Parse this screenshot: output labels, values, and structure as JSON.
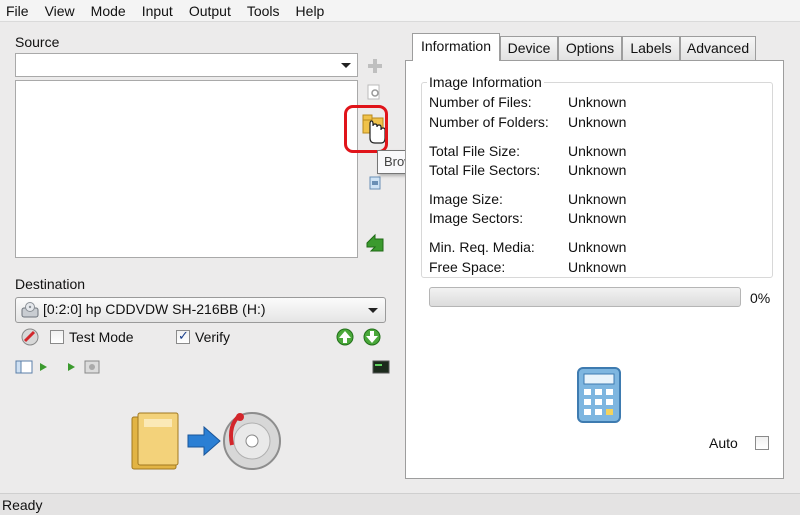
{
  "menu": [
    "File",
    "View",
    "Mode",
    "Input",
    "Output",
    "Tools",
    "Help"
  ],
  "source": {
    "label": "Source",
    "combo_value": "",
    "tooltip": "Browse for a folder..."
  },
  "toolbar_icons": [
    "add-icon",
    "search-file-icon",
    "browse-folder-icon",
    "remove-icon",
    "clear-icon",
    "go-back-icon"
  ],
  "destination": {
    "label": "Destination",
    "drive": "[0:2:0] hp CDDVDW SH-216BB (H:)",
    "test_mode_label": "Test Mode",
    "test_mode_checked": false,
    "verify_label": "Verify",
    "verify_checked": true
  },
  "tabs": [
    "Information",
    "Device",
    "Options",
    "Labels",
    "Advanced"
  ],
  "active_tab": "Information",
  "info": {
    "group_title": "Image Information",
    "rows": [
      {
        "label": "Number of Files:",
        "value": "Unknown"
      },
      {
        "label": "Number of Folders:",
        "value": "Unknown"
      },
      {
        "label": "Total File Size:",
        "value": "Unknown"
      },
      {
        "label": "Total File Sectors:",
        "value": "Unknown"
      },
      {
        "label": "Image Size:",
        "value": "Unknown"
      },
      {
        "label": "Image Sectors:",
        "value": "Unknown"
      },
      {
        "label": "Min. Req. Media:",
        "value": "Unknown"
      },
      {
        "label": "Free Space:",
        "value": "Unknown"
      }
    ],
    "progress_percent": 0,
    "progress_label": "0%",
    "auto_label": "Auto",
    "auto_checked": false
  },
  "status": "Ready",
  "colors": {
    "highlight": "#e0141a",
    "accent_green": "#3b9a2e"
  }
}
